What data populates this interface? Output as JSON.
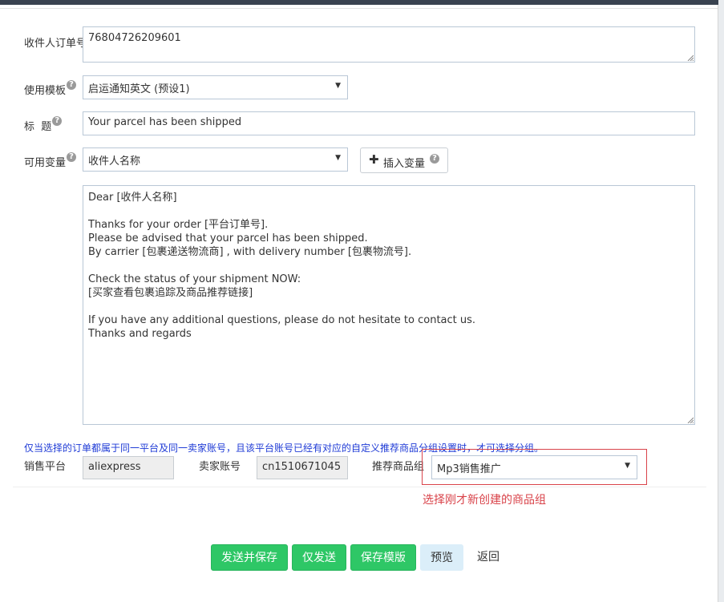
{
  "fields": {
    "order_no": {
      "label": "收件人订单号",
      "value": "76804726209601"
    },
    "template": {
      "label": "使用模板",
      "help": "?",
      "value": "启运通知英文 (预设1)"
    },
    "subject": {
      "label": "标  题",
      "help": "?",
      "value": "Your parcel has been shipped"
    },
    "variables": {
      "label": "可用变量",
      "help": "?",
      "value": "收件人名称"
    },
    "insert_button": {
      "icon": "plus-icon",
      "label": "插入变量",
      "help": "?"
    },
    "body": {
      "lines": [
        "Dear [收件人名称]",
        "",
        "Thanks for your order [平台订单号].",
        "Please be advised that your parcel has been shipped.",
        "By carrier [包裹递送物流商] , with delivery number [包裹物流号].",
        "",
        "Check the status of your shipment NOW:",
        "[买家查看包裹追踪及商品推荐链接]",
        "",
        "If you have any additional questions, please do not hesitate to contact us.",
        "Thanks and regards"
      ]
    }
  },
  "notice": "仅当选择的订单都属于同一平台及同一卖家账号，且该平台账号已经有对应的自定义推荐商品分组设置时，才可选择分组。",
  "platform": {
    "label": "销售平台",
    "value": "aliexpress"
  },
  "seller": {
    "label": "卖家账号",
    "value": "cn1510671045"
  },
  "group": {
    "label": "推荐商品组",
    "value": "Mp3销售推广"
  },
  "annotation": "选择刚才新创建的商品组",
  "buttons": {
    "send_save": "发送并保存",
    "send_only": "仅发送",
    "save_template": "保存模版",
    "preview": "预览",
    "back": "返回"
  },
  "colors": {
    "accent_green": "#2ec766",
    "notice_blue": "#1f3bd6",
    "annotation_red": "#d9434a"
  }
}
